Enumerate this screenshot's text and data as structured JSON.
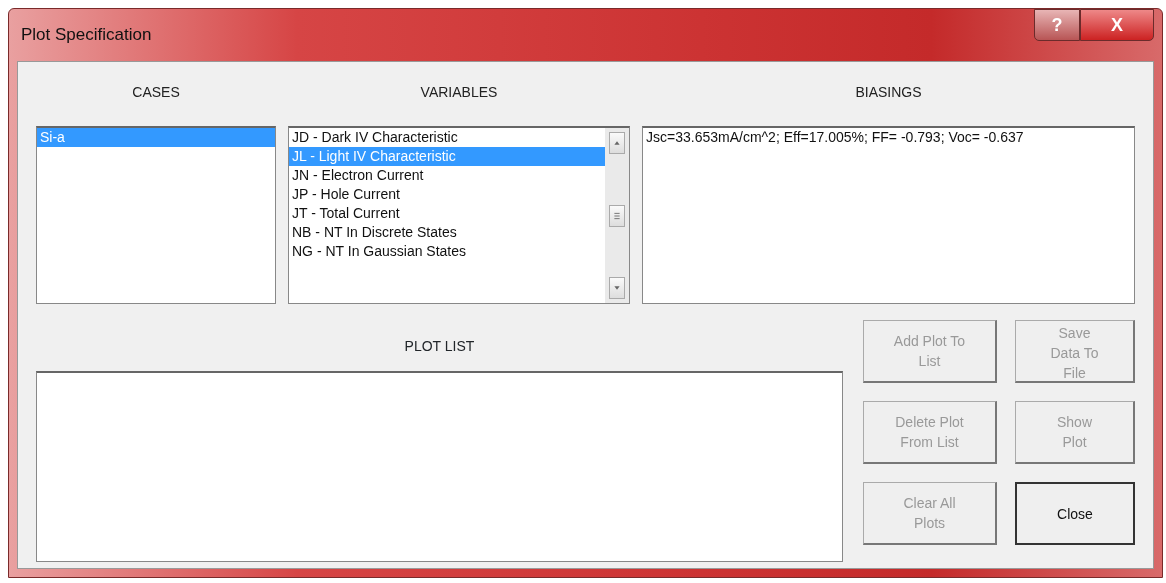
{
  "window": {
    "title": "Plot Specification",
    "controls": [
      "?",
      "X"
    ]
  },
  "cases": {
    "label": "CASES",
    "items": [
      {
        "text": "Si-a",
        "selected": true
      }
    ]
  },
  "variables": {
    "label": "VARIABLES",
    "items": [
      {
        "text": "JD - Dark IV Characteristic",
        "selected": false
      },
      {
        "text": "JL - Light IV Characteristic",
        "selected": true
      },
      {
        "text": "JN - Electron Current",
        "selected": false
      },
      {
        "text": "JP - Hole Current",
        "selected": false
      },
      {
        "text": "JT - Total Current",
        "selected": false
      },
      {
        "text": "NB - NT In Discrete States",
        "selected": false
      },
      {
        "text": "NG - NT In Gaussian States",
        "selected": false
      }
    ]
  },
  "biasings": {
    "label": "BIASINGS",
    "items": [
      {
        "text": "Jsc=33.653mA/cm^2; Eff=17.005%; FF= -0.793; Voc= -0.637",
        "selected": false
      }
    ]
  },
  "plot_list": {
    "label": "PLOT LIST"
  },
  "buttons": [
    {
      "text": "Add Plot To List",
      "disabled": true
    },
    {
      "text": "Save Data To File",
      "disabled": true
    },
    {
      "text": "Delete Plot From List",
      "disabled": true
    },
    {
      "text": "Show Plot",
      "disabled": true
    },
    {
      "text": "Clear All Plots",
      "disabled": true
    },
    {
      "text": "Close",
      "disabled": false
    }
  ]
}
